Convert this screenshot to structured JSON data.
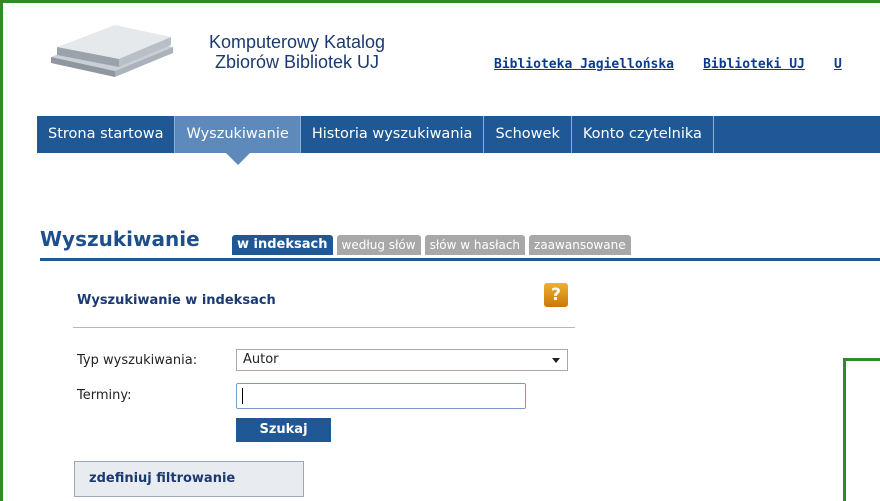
{
  "header": {
    "catalog_title_line1": "Komputerowy Katalog",
    "catalog_title_line2": "Zbiorów Bibliotek UJ",
    "links": [
      "Biblioteka Jagiellońska",
      "Biblioteki UJ",
      "U"
    ]
  },
  "nav": {
    "items": [
      "Strona startowa",
      "Wyszukiwanie",
      "Historia wyszukiwania",
      "Schowek",
      "Konto czytelnika"
    ],
    "active": "Wyszukiwanie"
  },
  "section": {
    "title": "Wyszukiwanie",
    "tabs": [
      "w indeksach",
      "według słów",
      "słów w hasłach",
      "zaawansowane"
    ],
    "active_tab": "w indeksach"
  },
  "form": {
    "title": "Wyszukiwanie w indeksach",
    "help_label": "?",
    "type_label": "Typ wyszukiwania:",
    "type_value": "Autor",
    "terms_label": "Terminy:",
    "terms_value": "",
    "search_button": "Szukaj",
    "filter_button": "zdefiniuj filtrowanie"
  },
  "colors": {
    "brand_blue": "#1f5895",
    "nav_active": "#5d89bb",
    "frame_green": "#2e8b26"
  }
}
